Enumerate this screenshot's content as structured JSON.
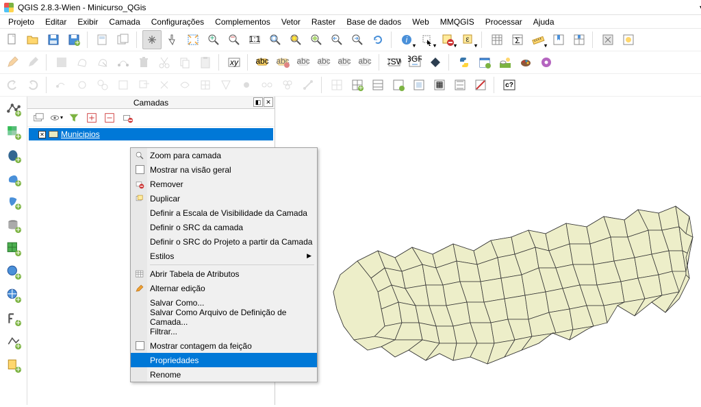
{
  "window": {
    "title": "QGIS 2.8.3-Wien - Minicurso_QGis"
  },
  "menubar": [
    "Projeto",
    "Editar",
    "Exibir",
    "Camada",
    "Configurações",
    "Complementos",
    "Vetor",
    "Raster",
    "Base de dados",
    "Web",
    "MMQGIS",
    "Processar",
    "Ajuda"
  ],
  "layers_panel": {
    "title": "Camadas",
    "layer": {
      "name": "Municipios",
      "checked": true
    }
  },
  "context_menu": {
    "items": [
      {
        "id": "zoom-layer",
        "label": "Zoom para camada",
        "icon": "magnifier"
      },
      {
        "id": "show-overview",
        "label": "Mostrar na visão geral",
        "icon": "checkbox"
      },
      {
        "id": "remove",
        "label": "Remover",
        "icon": "remove"
      },
      {
        "id": "duplicate",
        "label": "Duplicar",
        "icon": "duplicate"
      },
      {
        "id": "def-scale",
        "label": "Definir a Escala de Visibilidade da Camada"
      },
      {
        "id": "def-src",
        "label": "Definir o SRC da camada"
      },
      {
        "id": "def-src-proj",
        "label": "Definir o SRC do Projeto a partir da Camada"
      },
      {
        "id": "styles",
        "label": "Estilos",
        "submenu": true
      },
      {
        "sep": true
      },
      {
        "id": "attr-table",
        "label": "Abrir Tabela de Atributos",
        "icon": "table"
      },
      {
        "id": "toggle-edit",
        "label": "Alternar edição",
        "icon": "pencil"
      },
      {
        "id": "save-as",
        "label": "Salvar Como..."
      },
      {
        "id": "save-def",
        "label": "Salvar Como Arquivo de Definição de Camada..."
      },
      {
        "id": "filter",
        "label": "Filtrar..."
      },
      {
        "id": "show-count",
        "label": "Mostrar contagem da feição",
        "icon": "checkbox"
      },
      {
        "id": "properties",
        "label": "Propriedades",
        "highlight": true
      },
      {
        "id": "rename",
        "label": "Renome"
      }
    ]
  },
  "toolbar_c2": "c?"
}
